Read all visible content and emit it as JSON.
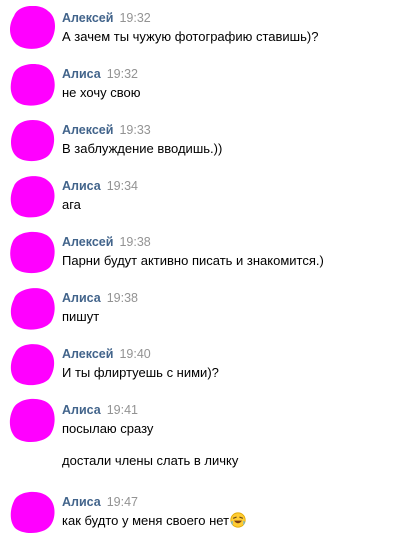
{
  "colors": {
    "author": "#42648b",
    "time": "#939393",
    "text": "#000000",
    "avatar_blob": "#ff00ff"
  },
  "messages": [
    {
      "author": "Алексей",
      "time": "19:32",
      "lines": [
        "А зачем ты чужую фотографию ставишь)?"
      ]
    },
    {
      "author": "Алиса",
      "time": "19:32",
      "lines": [
        "не хочу свою"
      ]
    },
    {
      "author": "Алексей",
      "time": "19:33",
      "lines": [
        "В заблуждение вводишь.))"
      ]
    },
    {
      "author": "Алиса",
      "time": "19:34",
      "lines": [
        "ага"
      ]
    },
    {
      "author": "Алексей",
      "time": "19:38",
      "lines": [
        "Парни будут активно писать и знакомится.)"
      ]
    },
    {
      "author": "Алиса",
      "time": "19:38",
      "lines": [
        "пишут"
      ]
    },
    {
      "author": "Алексей",
      "time": "19:40",
      "lines": [
        "И ты флиртуешь с ними)?"
      ]
    },
    {
      "author": "Алиса",
      "time": "19:41",
      "lines": [
        "посылаю сразу",
        "достали члены слать в личку"
      ]
    },
    {
      "author": "Алиса",
      "time": "19:47",
      "lines": [
        "как будто у меня своего нет"
      ],
      "emoji": "rolling-on-floor-laughing-emoji"
    }
  ]
}
